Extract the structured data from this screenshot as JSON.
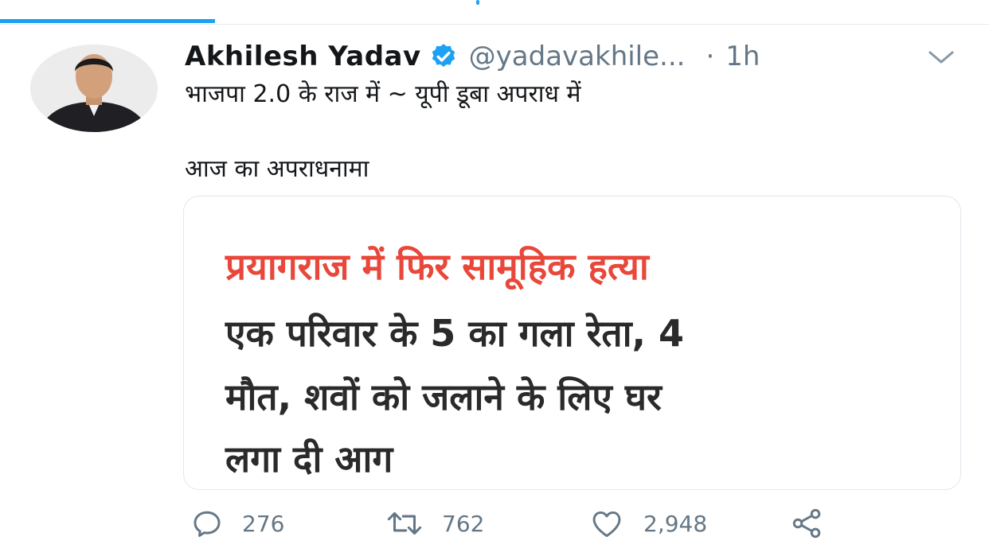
{
  "tweet": {
    "author_name": "Akhilesh Yadav",
    "handle": "@yadavakhile...",
    "separator": "·",
    "time": "1h",
    "text_line1": "भाजपा 2.0 के राज में ~ यूपी डूबा अपराध में",
    "text_line2": "आज का अपराधनामा"
  },
  "media": {
    "headline": "प्रयागराज में फिर सामूहिक हत्या",
    "body_line1": "एक परिवार के 5 का गला रेता, 4",
    "body_line2": "मौत, शवों को जलाने के लिए घर",
    "body_line3": "लगा दी आग"
  },
  "actions": {
    "reply_icon": "reply-icon",
    "reply_count": "276",
    "retweet_icon": "retweet-icon",
    "retweet_count": "762",
    "like_icon": "heart-icon",
    "like_count": "2,948",
    "share_icon": "share-icon"
  },
  "colors": {
    "accent": "#1da1f2",
    "headline_red": "#e8473a",
    "muted": "#657786"
  }
}
